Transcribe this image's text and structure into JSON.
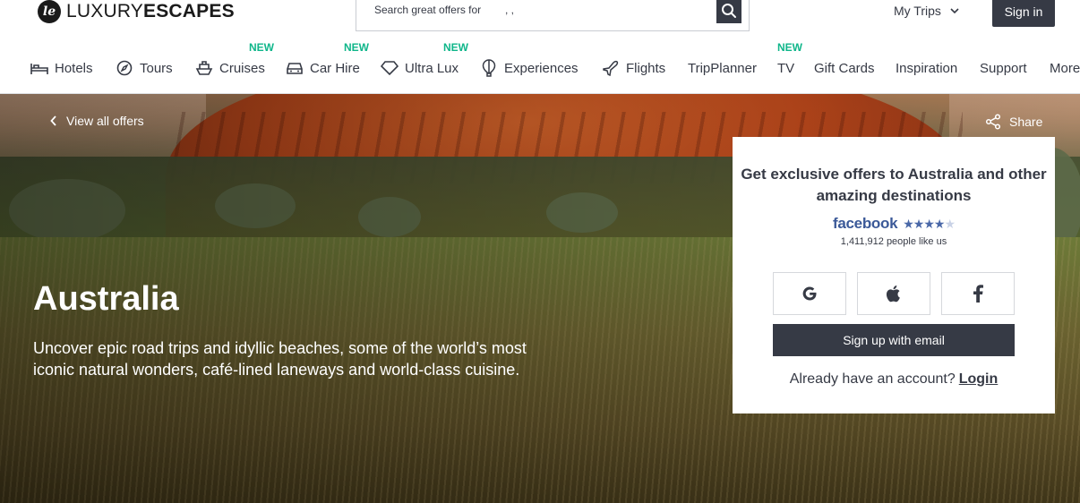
{
  "brand": {
    "name_light": "LUXURY",
    "name_bold": "ESCAPES",
    "monogram": "le"
  },
  "search": {
    "placeholder": "Search great offers for",
    "typed": ", ,"
  },
  "header": {
    "my_trips": "My Trips",
    "sign_in": "Sign in"
  },
  "nav": [
    {
      "label": "Hotels",
      "icon": "bed-icon",
      "new": ""
    },
    {
      "label": "Tours",
      "icon": "compass-icon",
      "new": ""
    },
    {
      "label": "Cruises",
      "icon": "ship-icon",
      "new": "NEW"
    },
    {
      "label": "Car Hire",
      "icon": "car-icon",
      "new": "NEW"
    },
    {
      "label": "Ultra Lux",
      "icon": "diamond-icon",
      "new": "NEW"
    },
    {
      "label": "Experiences",
      "icon": "balloon-icon",
      "new": ""
    },
    {
      "label": "Flights",
      "icon": "plane-icon",
      "new": ""
    },
    {
      "label": "TripPlanner",
      "icon": "",
      "new": ""
    },
    {
      "label": "TV",
      "icon": "",
      "new": "NEW"
    },
    {
      "label": "Gift Cards",
      "icon": "",
      "new": ""
    },
    {
      "label": "Inspiration",
      "icon": "",
      "new": ""
    },
    {
      "label": "Support",
      "icon": "",
      "new": ""
    },
    {
      "label": "More",
      "icon": "",
      "new": ""
    }
  ],
  "hero": {
    "back_link": "View all offers",
    "share": "Share",
    "title": "Australia",
    "description": "Uncover epic road trips and idyllic beaches, some of the world’s most iconic natural wonders, café-lined laneways and world-class cuisine."
  },
  "signup": {
    "title": "Get exclusive offers to Australia and other amazing destinations",
    "facebook_word": "facebook",
    "rating_stars": 4.5,
    "likes": "1,411,912 people like us",
    "email_button": "Sign up with email",
    "already": "Already have an account?",
    "login": "Login"
  },
  "colors": {
    "dark": "#363a45",
    "new_badge": "#0fb68a",
    "facebook": "#3b5998"
  }
}
